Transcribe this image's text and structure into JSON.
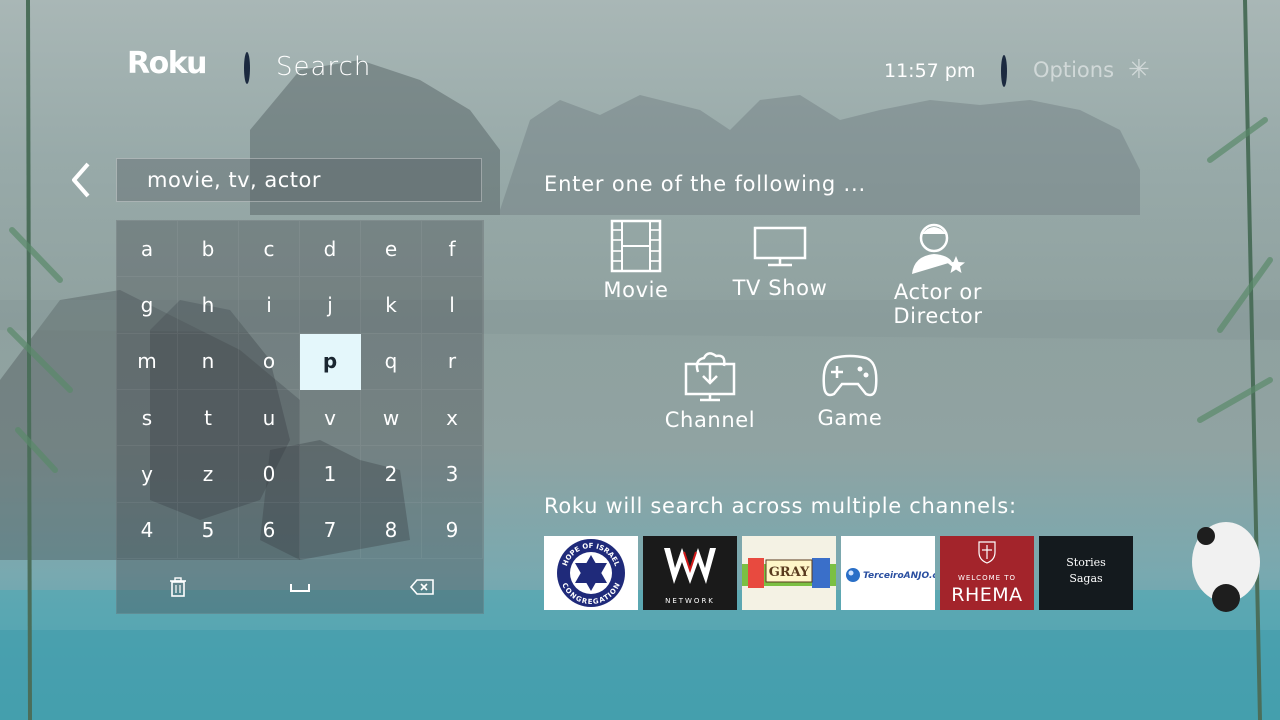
{
  "header": {
    "logo": "Roku",
    "title": "Search",
    "time": "11:57  pm",
    "options_label": "Options",
    "options_icon": "asterisk-icon"
  },
  "search": {
    "placeholder": "movie, tv, actor",
    "back_icon": "chevron-left-icon"
  },
  "keyboard": {
    "keys": [
      "a",
      "b",
      "c",
      "d",
      "e",
      "f",
      "g",
      "h",
      "i",
      "j",
      "k",
      "l",
      "m",
      "n",
      "o",
      "p",
      "q",
      "r",
      "s",
      "t",
      "u",
      "v",
      "w",
      "x",
      "y",
      "z",
      "0",
      "1",
      "2",
      "3",
      "4",
      "5",
      "6",
      "7",
      "8",
      "9"
    ],
    "selected": "p",
    "bottom_actions": [
      {
        "name": "clear",
        "icon": "trash-icon"
      },
      {
        "name": "space",
        "icon": "space-icon"
      },
      {
        "name": "backspace",
        "icon": "backspace-icon"
      }
    ]
  },
  "main": {
    "enter_title": "Enter one of the following ...",
    "options": [
      {
        "label": "Movie",
        "icon": "film-icon"
      },
      {
        "label": "TV Show",
        "icon": "tv-icon"
      },
      {
        "label": "Actor or",
        "label2": "Director",
        "icon": "person-star-icon"
      },
      {
        "label": "Channel",
        "icon": "channel-download-icon"
      },
      {
        "label": "Game",
        "icon": "gamepad-icon"
      }
    ],
    "multi_title": "Roku will search across multiple channels:",
    "channels": [
      {
        "name": "hope-of-israel",
        "ring_top": "HOPE OF ISRAEL",
        "ring_bottom": "CONGREGATION"
      },
      {
        "name": "wwe-network",
        "caption": "NETWORK"
      },
      {
        "name": "gray",
        "caption": "GRAY"
      },
      {
        "name": "terceiro-anjo",
        "caption": "TerceiroANJO.com"
      },
      {
        "name": "rhema",
        "caption_small": "WELCOME TO",
        "caption": "RHEMA"
      },
      {
        "name": "stories-and-sagas",
        "caption": "Stories",
        "caption2": "Sagas"
      }
    ]
  },
  "colors": {
    "selected_key_bg": "#e4f7fb",
    "separator": "#1c2a40",
    "rhema": "#a3242b"
  }
}
